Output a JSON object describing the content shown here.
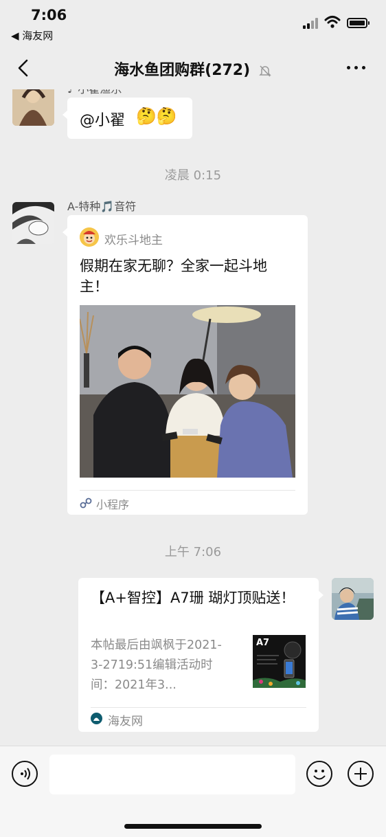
{
  "status_bar": {
    "time": "7:06",
    "back_app": "◀ 海友网"
  },
  "nav": {
    "title": "海水鱼团购群(272)"
  },
  "messages": {
    "partial_sender": "♪ 小翟渔乐",
    "mention": "@小翟",
    "mention_emoji": "🤔🤔",
    "timestamp1": "凌晨 0:15",
    "sender2": "A-特种🎵音符",
    "mini_app_name": "欢乐斗地主",
    "mini_app_title": "假期在家无聊？全家一起斗地主！",
    "mini_program_label": "小程序",
    "timestamp2": "上午 7:06",
    "link_title": "【A+智控】A7珊 瑚灯顶贴送！",
    "link_desc": "本帖最后由飒枫于2021-3-2719:51编辑活动时间：2021年3...",
    "link_thumb_label": "A7",
    "link_source": "海友网"
  },
  "input": {
    "placeholder": ""
  },
  "colors": {
    "background": "#ededed",
    "bubble": "#ffffff",
    "timestamp": "#9a9a9a",
    "miniprogram_link": "#576b95"
  }
}
